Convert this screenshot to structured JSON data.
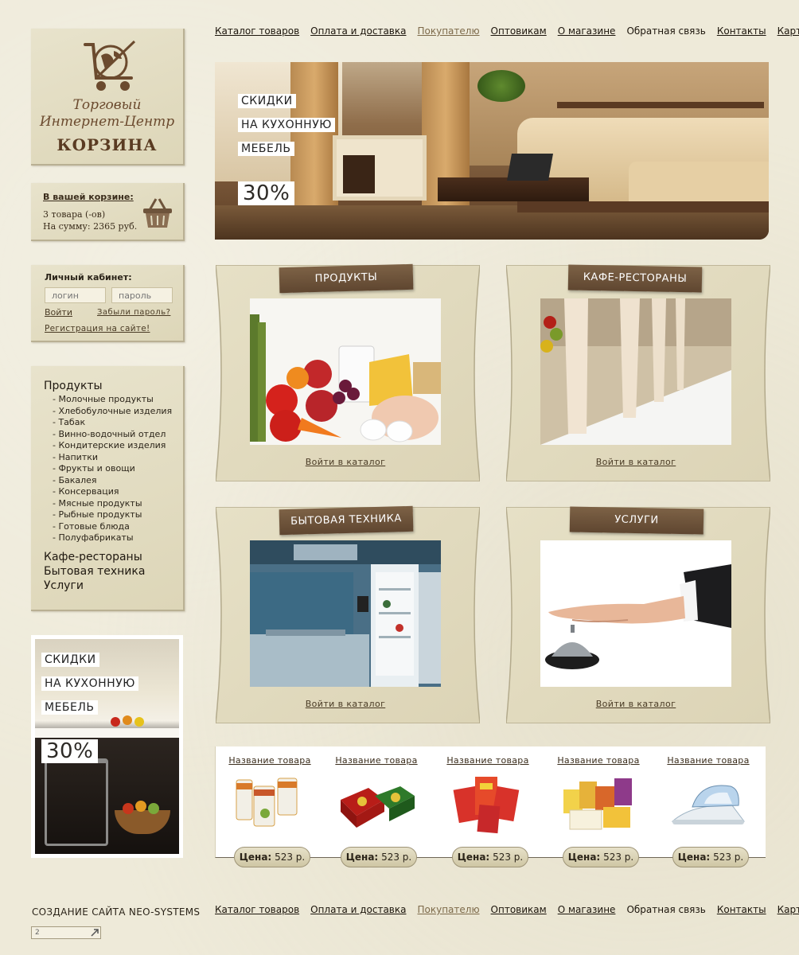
{
  "logo": {
    "line1": "Торговый",
    "line2": "Интернет-Центр",
    "name": "КОРЗИНА"
  },
  "cart": {
    "title": "В вашей корзине:",
    "count": "3 товара (-ов)",
    "sum": "На сумму: 2365 руб."
  },
  "login": {
    "title": "Личный кабинет:",
    "login_placeholder": "логин",
    "password_placeholder": "пароль",
    "submit": "Войти",
    "forgot": "Забыли пароль?",
    "register": "Регистрация на сайте!"
  },
  "categories": {
    "main": [
      "Продукты",
      "Кафе-рестораны",
      "Бытовая техника",
      "Услуги"
    ],
    "sub": [
      "- Молочные продукты",
      "- Хлебобулочные изделия",
      "- Табак",
      "- Винно-водочный отдел",
      "- Кондитерские изделия",
      "- Напитки",
      "- Фрукты и овощи",
      "- Бакалея",
      "- Консервация",
      "- Мясные продукты",
      "- Рыбные продукты",
      "- Готовые блюда",
      "- Полуфабрикаты"
    ]
  },
  "promo": {
    "line1": "СКИДКИ",
    "line2": "НА КУХОННУЮ",
    "line3": "МЕБЕЛЬ",
    "discount": "30%"
  },
  "nav": {
    "items": [
      "Каталог товаров",
      "Оплата и доставка",
      "Покупателю",
      "Оптовикам",
      "О магазине",
      "Обратная связь",
      "Контакты",
      "Карта сайта"
    ]
  },
  "cards": [
    {
      "title": "ПРОДУКТЫ",
      "link": "Войти в каталог"
    },
    {
      "title": "КАФЕ-РЕСТОРАНЫ",
      "link": "Войти в каталог"
    },
    {
      "title": "БЫТОВАЯ ТЕХНИКА",
      "link": "Войти в каталог"
    },
    {
      "title": "УСЛУГИ",
      "link": "Войти в каталог"
    }
  ],
  "products": [
    {
      "name": "Название товара",
      "price_label": "Цена:",
      "price": "523 р."
    },
    {
      "name": "Название товара",
      "price_label": "Цена:",
      "price": "523 р."
    },
    {
      "name": "Название товара",
      "price_label": "Цена:",
      "price": "523 р."
    },
    {
      "name": "Название товара",
      "price_label": "Цена:",
      "price": "523 р."
    },
    {
      "name": "Название товара",
      "price_label": "Цена:",
      "price": "523 р."
    }
  ],
  "footer": {
    "credit": "СОЗДАНИЕ САЙТА NEO-SYSTEMS",
    "counter": "2"
  },
  "colors": {
    "background": "#eeead9",
    "panel": "#e1dbc0",
    "tab": "#6e543b",
    "text": "#2b2419"
  }
}
